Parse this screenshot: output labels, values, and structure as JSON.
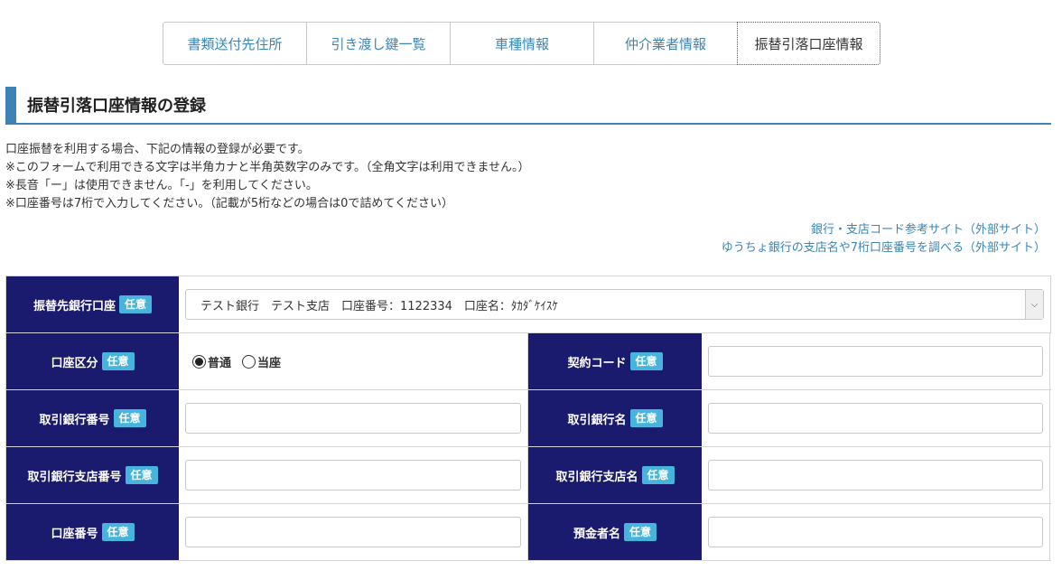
{
  "tabs": [
    {
      "label": "書類送付先住所"
    },
    {
      "label": "引き渡し鍵一覧"
    },
    {
      "label": "車種情報"
    },
    {
      "label": "仲介業者情報"
    },
    {
      "label": "振替引落口座情報"
    }
  ],
  "section_title": "振替引落口座情報の登録",
  "notes": [
    "口座振替を利用する場合、下記の情報の登録が必要です。",
    "※このフォームで利用できる文字は半角カナと半角英数字のみです。（全角文字は利用できません。）",
    "※長音「ー」は使用できません。「-」を利用してください。",
    "※口座番号は7桁で入力してください。（記載が5桁などの場合は0で詰めてください）"
  ],
  "links": [
    "銀行・支店コード参考サイト（外部サイト）",
    "ゆうちょ銀行の支店名や7桁口座番号を調べる（外部サイト）"
  ],
  "badge": "任意",
  "form": {
    "bank_account": {
      "label": "振替先銀行口座",
      "selected": "テスト銀行　テスト支店　口座番号：1122334　口座名：ﾀｶﾀﾞｹｲｽｹ"
    },
    "account_type": {
      "label": "口座区分",
      "options": [
        "普通",
        "当座"
      ],
      "selected": "普通"
    },
    "contract_code": {
      "label": "契約コード",
      "value": ""
    },
    "bank_number": {
      "label": "取引銀行番号",
      "value": ""
    },
    "bank_name": {
      "label": "取引銀行名",
      "value": ""
    },
    "branch_number": {
      "label": "取引銀行支店番号",
      "value": ""
    },
    "branch_name": {
      "label": "取引銀行支店名",
      "value": ""
    },
    "account_number": {
      "label": "口座番号",
      "value": ""
    },
    "depositor_name": {
      "label": "預金者名",
      "value": ""
    }
  }
}
